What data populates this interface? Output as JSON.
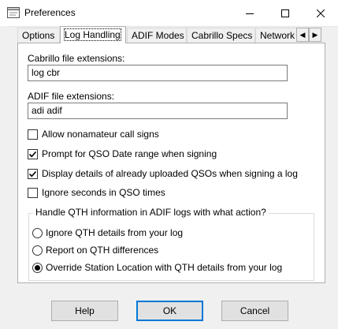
{
  "window": {
    "title": "Preferences",
    "controls": {
      "minimize": "─",
      "maximize": "☐",
      "close": "✕"
    }
  },
  "tabs": [
    {
      "label": "Options",
      "active": false
    },
    {
      "label": "Log Handling",
      "active": true
    },
    {
      "label": "ADIF Modes",
      "active": false
    },
    {
      "label": "Cabrillo Specs",
      "active": false
    },
    {
      "label": "Network",
      "active": false
    }
  ],
  "tab_scroll": {
    "left": "◀",
    "right": "▶"
  },
  "cabrillo": {
    "label": "Cabrillo file extensions:",
    "value": "log cbr"
  },
  "adif": {
    "label": "ADIF file extensions:",
    "value": "adi adif"
  },
  "checkboxes": [
    {
      "label": "Allow nonamateur call signs",
      "checked": false
    },
    {
      "label": "Prompt for QSO Date range when signing",
      "checked": true
    },
    {
      "label": "Display details of already uploaded QSOs when signing a log",
      "checked": true
    },
    {
      "label": "Ignore seconds in QSO times",
      "checked": false
    }
  ],
  "qth_group": {
    "title": "Handle QTH information in ADIF logs with what action?",
    "options": [
      {
        "label": "Ignore QTH details from your log",
        "selected": false
      },
      {
        "label": "Report on QTH differences",
        "selected": false
      },
      {
        "label": "Override Station Location with QTH details from your log",
        "selected": true
      }
    ]
  },
  "buttons": {
    "help": "Help",
    "ok": "OK",
    "cancel": "Cancel"
  },
  "colors": {
    "focus_border": "#0078d7",
    "dialog_bg": "#f0f0f0",
    "panel_bg": "#ffffff"
  }
}
